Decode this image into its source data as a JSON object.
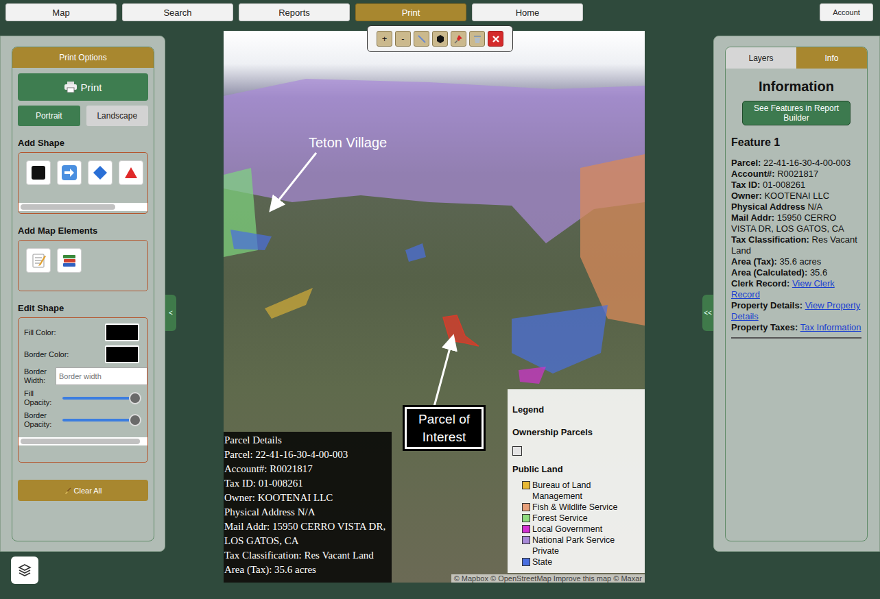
{
  "nav": {
    "items": [
      {
        "label": "Map",
        "selected": false
      },
      {
        "label": "Search",
        "selected": false
      },
      {
        "label": "Reports",
        "selected": false
      },
      {
        "label": "Print",
        "selected": true
      },
      {
        "label": "Home",
        "selected": false
      }
    ],
    "account": "Account"
  },
  "print_panel": {
    "title": "Print Options",
    "print_button": "Print",
    "orientations": [
      {
        "label": "Portrait",
        "selected": true
      },
      {
        "label": "Landscape",
        "selected": false
      }
    ],
    "add_shape": {
      "title": "Add Shape",
      "shapes": [
        {
          "kind": "square"
        },
        {
          "kind": "arrow"
        },
        {
          "kind": "diamond"
        },
        {
          "kind": "triangle"
        }
      ]
    },
    "add_map_elements": {
      "title": "Add Map Elements",
      "elements": [
        {
          "kind": "text"
        },
        {
          "kind": "legend"
        }
      ]
    },
    "edit_shape": {
      "title": "Edit Shape",
      "fill_color": {
        "label": "Fill Color:",
        "value": "#000000"
      },
      "border_color": {
        "label": "Border Color:",
        "value": "#000000"
      },
      "border_width": {
        "label": "Border Width:",
        "placeholder": "Border width"
      },
      "fill_opacity": {
        "label": "Fill Opacity:",
        "level": 1
      },
      "border_opacity": {
        "label": "Border Opacity:",
        "level": 1
      }
    },
    "clear_button": "Clear All"
  },
  "left_toggle": "<",
  "right_toggle": "<<",
  "toolbar": [
    {
      "kind": "text",
      "label": "+"
    },
    {
      "kind": "text",
      "label": "-"
    },
    {
      "kind": "line"
    },
    {
      "kind": "polygon"
    },
    {
      "kind": "pin"
    },
    {
      "kind": "trash"
    },
    {
      "kind": "close"
    }
  ],
  "map": {
    "annotations": [
      {
        "kind": "label",
        "text": "Teton Village"
      },
      {
        "kind": "box",
        "text": "Parcel of Interest"
      }
    ],
    "details": {
      "title": "Parcel Details",
      "lines": [
        "Parcel: 22-41-16-30-4-00-003",
        "Account#: R0021817",
        "Tax ID: 01-008261",
        "Owner: KOOTENAI LLC",
        "Physical Address N/A",
        "Mail Addr: 15950 CERRO VISTA DR, LOS GATOS, CA",
        "Tax Classification: Res Vacant Land",
        "Area (Tax): 35.6 acres"
      ]
    },
    "legend": {
      "title": "Legend",
      "ownership": {
        "title": "Ownership Parcels",
        "color": "#e4e4e4"
      },
      "public_land": {
        "title": "Public Land",
        "items": [
          {
            "label": "Bureau of Land Management",
            "color": "#e8b935"
          },
          {
            "label": "Fish & Wildlife Service",
            "color": "#e8a07a"
          },
          {
            "label": "Forest Service",
            "color": "#8fdc7f"
          },
          {
            "label": "Local Government",
            "color": "#d230d2"
          },
          {
            "label": "National Park Service",
            "color": "#a88ad8"
          },
          {
            "label": "Private",
            "color": null
          },
          {
            "label": "State",
            "color": "#4a6fe0"
          }
        ]
      }
    },
    "attribution": "© Mapbox © OpenStreetMap Improve this map © Maxar"
  },
  "info_panel": {
    "tabs": [
      {
        "label": "Layers",
        "selected": false
      },
      {
        "label": "Info",
        "selected": true
      }
    ],
    "heading": "Information",
    "report_button": "See Features in Report Builder",
    "feature_title": "Feature 1",
    "fields": [
      {
        "label": "Parcel:",
        "value": "22-41-16-30-4-00-003",
        "link": false
      },
      {
        "label": "Account#:",
        "value": "R0021817",
        "link": false
      },
      {
        "label": "Tax ID:",
        "value": "01-008261",
        "link": false
      },
      {
        "label": "Owner:",
        "value": "KOOTENAI LLC",
        "link": false
      },
      {
        "label": "Physical Address",
        "value": "N/A",
        "link": false
      },
      {
        "label": "Mail Addr:",
        "value": "15950 CERRO VISTA DR, LOS GATOS, CA",
        "link": false
      },
      {
        "label": "Tax Classification:",
        "value": "Res Vacant Land",
        "link": false
      },
      {
        "label": "Area (Tax):",
        "value": "35.6 acres",
        "link": false
      },
      {
        "label": "Area (Calculated):",
        "value": "35.6",
        "link": false
      },
      {
        "label": "Clerk Record:",
        "value": "View Clerk Record",
        "link": true
      },
      {
        "label": "Property Details:",
        "value": "View Property Details",
        "link": true
      },
      {
        "label": "Property Taxes:",
        "value": "Tax Information",
        "link": true
      }
    ]
  }
}
